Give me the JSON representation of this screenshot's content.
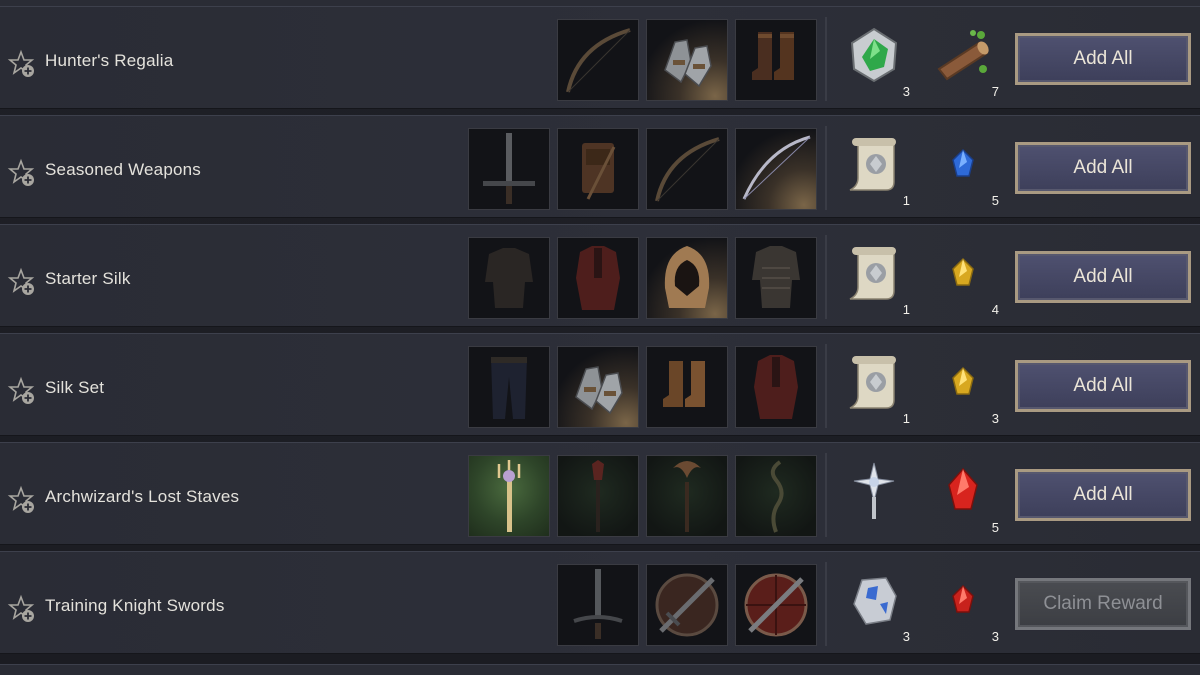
{
  "rows": [
    {
      "title": "Hunter's Regalia",
      "items": [
        "bow-icon",
        "gauntlets-icon",
        "boots-icon"
      ],
      "rewards": [
        {
          "icon": "green-gem-icon",
          "qty": "3"
        },
        {
          "icon": "wood-log-icon",
          "qty": "7"
        }
      ],
      "button": "Add All"
    },
    {
      "title": "Seasoned Weapons",
      "items": [
        "greatsword-icon",
        "satchel-crossbow-icon",
        "bow-icon",
        "longbow-icon"
      ],
      "rewards": [
        {
          "icon": "scroll-icon",
          "qty": "1"
        },
        {
          "icon": "blue-crystal-icon",
          "qty": "5"
        }
      ],
      "button": "Add All"
    },
    {
      "title": "Starter Silk",
      "items": [
        "dark-armor-icon",
        "red-robe-icon",
        "hood-icon",
        "chainmail-icon"
      ],
      "rewards": [
        {
          "icon": "scroll-icon",
          "qty": "1"
        },
        {
          "icon": "yellow-crystal-icon",
          "qty": "4"
        }
      ],
      "button": "Add All"
    },
    {
      "title": "Silk Set",
      "items": [
        "trousers-icon",
        "gauntlets-icon",
        "boots-icon",
        "red-robe-icon"
      ],
      "rewards": [
        {
          "icon": "scroll-icon",
          "qty": "1"
        },
        {
          "icon": "yellow-crystal-icon",
          "qty": "3"
        }
      ],
      "button": "Add All"
    },
    {
      "title": "Archwizard's Lost Staves",
      "items": [
        "golden-staff-icon",
        "dark-staff-icon",
        "crescent-staff-icon",
        "twisted-staff-icon"
      ],
      "rewards": [
        {
          "icon": "star-scepter-icon",
          "qty": ""
        },
        {
          "icon": "red-crystal-icon",
          "qty": "5"
        }
      ],
      "button": "Add All"
    },
    {
      "title": "Training Knight Swords",
      "items": [
        "sword-icon",
        "sword-shield-icon",
        "sword-shield-red-icon"
      ],
      "rewards": [
        {
          "icon": "ore-icon",
          "qty": "3"
        },
        {
          "icon": "red-crystal-icon",
          "qty": "3"
        }
      ],
      "button": "Claim Reward"
    }
  ],
  "colors": {
    "button_border": "#a99a82",
    "button_fill": "#4f5170",
    "disabled_fill": "#4a4c51",
    "text": "#e4e2dc"
  }
}
